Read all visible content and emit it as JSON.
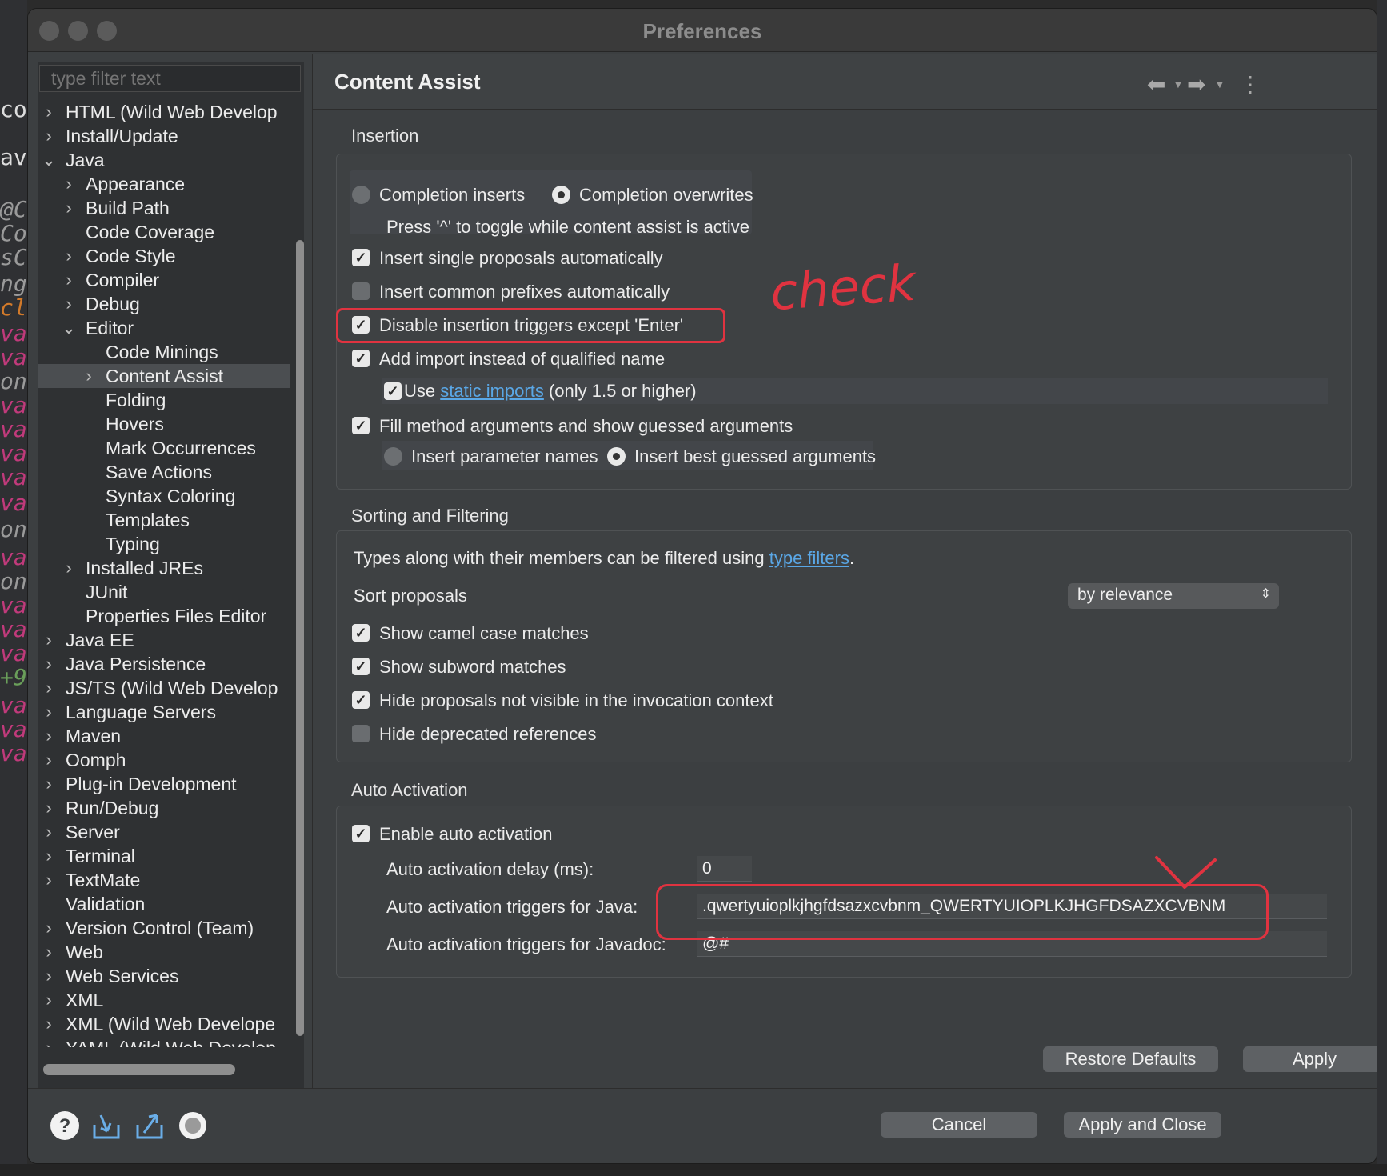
{
  "window": {
    "title": "Preferences"
  },
  "filter": {
    "placeholder": "type filter text"
  },
  "tree": [
    {
      "label": "HTML (Wild Web Develop",
      "expandable": true,
      "expanded": false
    },
    {
      "label": "Install/Update",
      "expandable": true,
      "expanded": false
    },
    {
      "label": "Java",
      "expandable": true,
      "expanded": true
    },
    {
      "label": "Appearance",
      "expandable": true,
      "expanded": false
    },
    {
      "label": "Build Path",
      "expandable": true,
      "expanded": false
    },
    {
      "label": "Code Coverage",
      "expandable": false
    },
    {
      "label": "Code Style",
      "expandable": true,
      "expanded": false
    },
    {
      "label": "Compiler",
      "expandable": true,
      "expanded": false
    },
    {
      "label": "Debug",
      "expandable": true,
      "expanded": false
    },
    {
      "label": "Editor",
      "expandable": true,
      "expanded": true
    },
    {
      "label": "Code Minings",
      "expandable": false
    },
    {
      "label": "Content Assist",
      "expandable": true,
      "expanded": false,
      "selected": true
    },
    {
      "label": "Folding",
      "expandable": false
    },
    {
      "label": "Hovers",
      "expandable": false
    },
    {
      "label": "Mark Occurrences",
      "expandable": false
    },
    {
      "label": "Save Actions",
      "expandable": false
    },
    {
      "label": "Syntax Coloring",
      "expandable": false
    },
    {
      "label": "Templates",
      "expandable": false
    },
    {
      "label": "Typing",
      "expandable": false
    },
    {
      "label": "Installed JREs",
      "expandable": true,
      "expanded": false
    },
    {
      "label": "JUnit",
      "expandable": false
    },
    {
      "label": "Properties Files Editor",
      "expandable": false
    },
    {
      "label": "Java EE",
      "expandable": true,
      "expanded": false
    },
    {
      "label": "Java Persistence",
      "expandable": true,
      "expanded": false
    },
    {
      "label": "JS/TS (Wild Web Develop",
      "expandable": true,
      "expanded": false
    },
    {
      "label": "Language Servers",
      "expandable": true,
      "expanded": false
    },
    {
      "label": "Maven",
      "expandable": true,
      "expanded": false
    },
    {
      "label": "Oomph",
      "expandable": true,
      "expanded": false
    },
    {
      "label": "Plug-in Development",
      "expandable": true,
      "expanded": false
    },
    {
      "label": "Run/Debug",
      "expandable": true,
      "expanded": false
    },
    {
      "label": "Server",
      "expandable": true,
      "expanded": false
    },
    {
      "label": "Terminal",
      "expandable": true,
      "expanded": false
    },
    {
      "label": "TextMate",
      "expandable": true,
      "expanded": false
    },
    {
      "label": "Validation",
      "expandable": false
    },
    {
      "label": "Version Control (Team)",
      "expandable": true,
      "expanded": false
    },
    {
      "label": "Web",
      "expandable": true,
      "expanded": false
    },
    {
      "label": "Web Services",
      "expandable": true,
      "expanded": false
    },
    {
      "label": "XML",
      "expandable": true,
      "expanded": false
    },
    {
      "label": "XML (Wild Web Develope",
      "expandable": true,
      "expanded": false
    },
    {
      "label": "YAML (Wild Web Develop",
      "expandable": true,
      "expanded": false
    }
  ],
  "page": {
    "title": "Content Assist",
    "nav": {
      "back": "⬅",
      "forward": "➡",
      "menu": "⋮"
    }
  },
  "insertion": {
    "title": "Insertion",
    "radio_inserts": "Completion inserts",
    "radio_overwrites": "Completion overwrites",
    "toggle_hint": "Press '^' to toggle while content assist is active",
    "single_proposals": "Insert single proposals automatically",
    "common_prefixes": "Insert common prefixes automatically",
    "disable_triggers": "Disable insertion triggers except 'Enter'",
    "add_import": "Add import instead of qualified name",
    "use_prefix": "Use ",
    "static_imports_link": "static imports",
    "use_suffix": " (only 1.5 or higher)",
    "fill_args": "Fill method arguments and show guessed arguments",
    "param_names": "Insert parameter names",
    "best_guessed": "Insert best guessed arguments"
  },
  "sorting": {
    "title": "Sorting and Filtering",
    "types_text": "Types along with their members can be filtered using ",
    "type_filters_link": "type filters",
    "types_end": ".",
    "sort_label": "Sort proposals",
    "sort_value": "by relevance",
    "camel_case": "Show camel case matches",
    "subword": "Show subword matches",
    "hide_not_visible": "Hide proposals not visible in the invocation context",
    "hide_deprecated": "Hide deprecated references"
  },
  "auto_activation": {
    "title": "Auto Activation",
    "enable": "Enable auto activation",
    "delay_label": "Auto activation delay (ms):",
    "delay_value": "0",
    "java_label": "Auto activation triggers for Java:",
    "java_value": ".qwertyuioplkjhgfdsazxcvbnm_QWERTYUIOPLKJHGFDSAZXCVBNM",
    "javadoc_label": "Auto activation triggers for Javadoc:",
    "javadoc_value": "@#"
  },
  "buttons": {
    "restore_defaults": "Restore Defaults",
    "apply": "Apply",
    "cancel": "Cancel",
    "apply_close": "Apply and Close"
  },
  "annotation": {
    "text": "check"
  },
  "colors": {
    "annotation_red": "#e03340",
    "link_blue": "#5aa7e6",
    "panel_bg": "#3c3f41"
  }
}
